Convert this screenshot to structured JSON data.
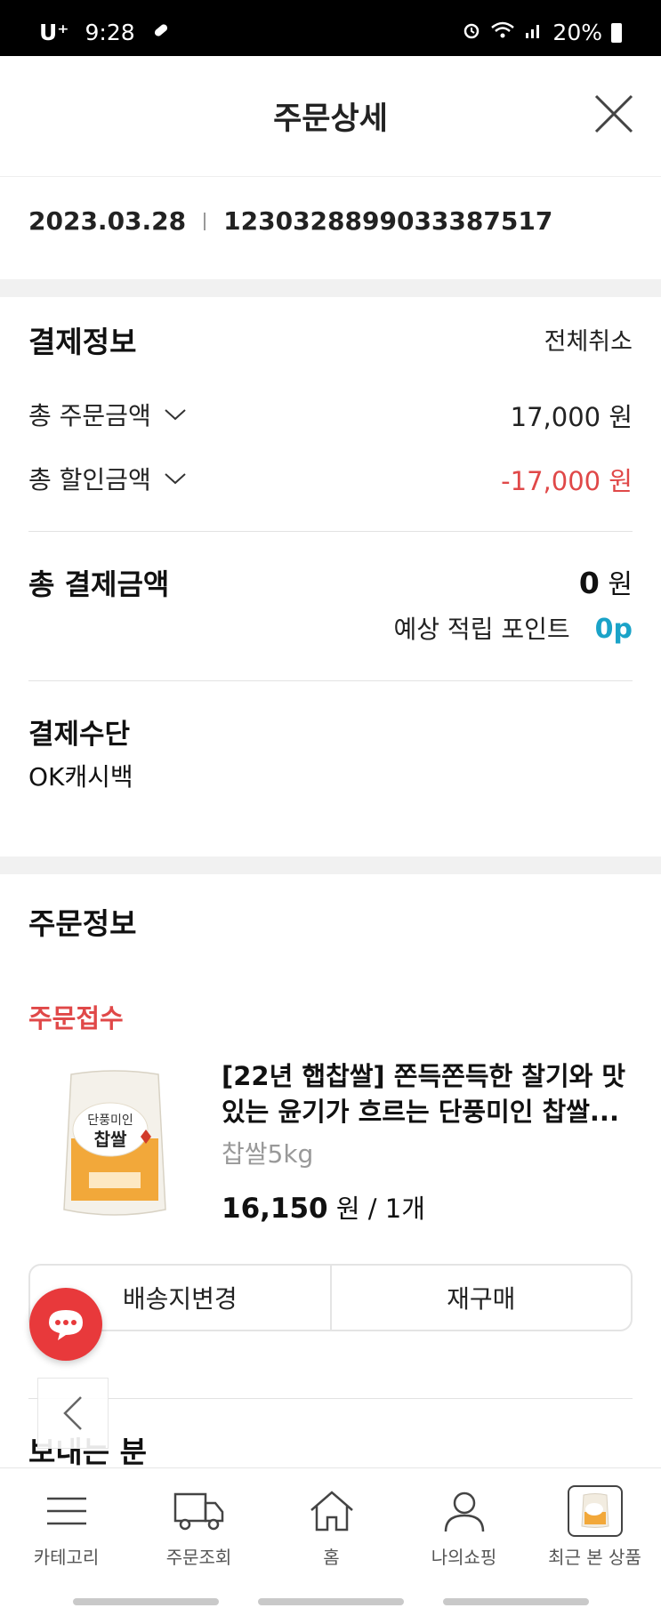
{
  "status_bar": {
    "carrier": "U⁺",
    "time": "9:28",
    "battery": "20%"
  },
  "header": {
    "title": "주문상세"
  },
  "order": {
    "date": "2023.03.28",
    "number": "1230328899033387517"
  },
  "payment": {
    "title": "결제정보",
    "cancel_all": "전체취소",
    "total_order_label": "총 주문금액",
    "total_order_value": "17,000 원",
    "total_discount_label": "총 할인금액",
    "total_discount_value": "-17,000 원",
    "total_payment_label": "총 결제금액",
    "total_payment_amount": "0",
    "total_payment_unit": "원",
    "points_label": "예상 적립 포인트",
    "points_value": "0p",
    "method_title": "결제수단",
    "method_value": "OK캐시백"
  },
  "order_info": {
    "title": "주문정보",
    "status": "주문접수",
    "product": {
      "name": "[22년 햅찹쌀] 쫀득쫀득한 찰기와 맛있는 윤기가 흐르는 단풍미인 찹쌀...",
      "option": "찹쌀5kg",
      "price": "16,150",
      "price_suffix": "원 / 1개",
      "image_text_top": "단풍미인",
      "image_text_main": "찹쌀"
    },
    "change_address_label": "배송지변경",
    "reorder_label": "재구매"
  },
  "sender": {
    "title": "보내는 분"
  },
  "bottom_nav": {
    "items": [
      {
        "label": "카테고리",
        "icon": "menu-icon"
      },
      {
        "label": "주문조회",
        "icon": "truck-icon"
      },
      {
        "label": "홈",
        "icon": "home-icon"
      },
      {
        "label": "나의쇼핑",
        "icon": "person-icon"
      },
      {
        "label": "최근 본 상품",
        "icon": "recent-product-thumbnail"
      }
    ]
  },
  "colors": {
    "accent_red": "#e04848",
    "points_blue": "#1aa3c8",
    "chat_red": "#e8393b"
  }
}
